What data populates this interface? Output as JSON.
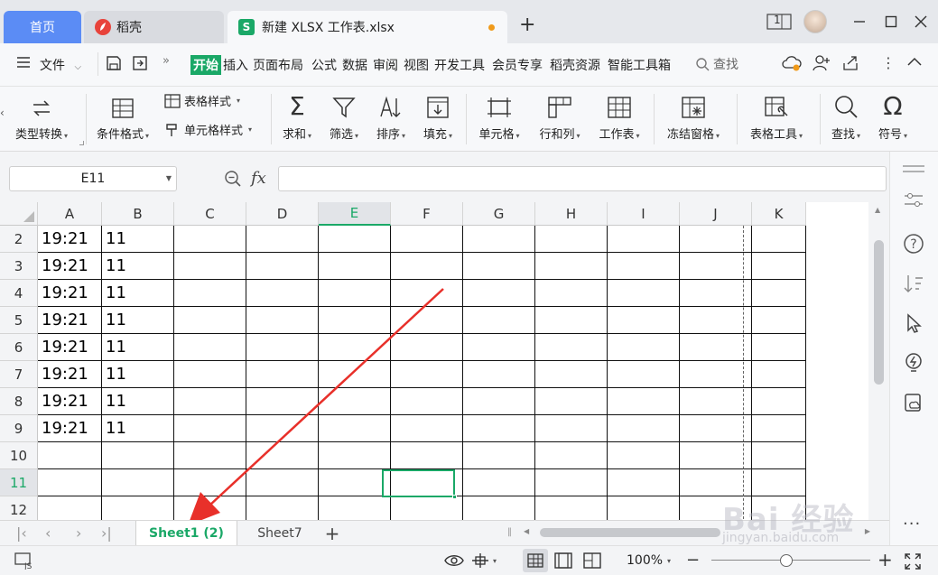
{
  "titlebar": {
    "home_tab": "首页",
    "daoke_tab": "稻壳",
    "file_tab": "新建 XLSX 工作表.xlsx",
    "new_tab": "+",
    "window_count": "1"
  },
  "menubar": {
    "file_menu": "文件",
    "items": [
      "开始",
      "插入",
      "页面布局",
      "公式",
      "数据",
      "审阅",
      "视图",
      "开发工具",
      "会员专享",
      "稻壳资源",
      "智能工具箱"
    ],
    "search": "查找"
  },
  "ribbon": {
    "type_convert": "类型转换",
    "cond_format": "条件格式",
    "table_style": "表格样式",
    "cell_style": "单元格样式",
    "sum": "求和",
    "filter": "筛选",
    "sort": "排序",
    "fill": "填充",
    "cell": "单元格",
    "row_col": "行和列",
    "worksheet": "工作表",
    "freeze": "冻结窗格",
    "table_tools": "表格工具",
    "find": "查找",
    "symbol": "符号"
  },
  "formula": {
    "name_box": "E11",
    "fx_label": "fx",
    "content": ""
  },
  "grid": {
    "columns": [
      "A",
      "B",
      "C",
      "D",
      "E",
      "F",
      "G",
      "H",
      "I",
      "J",
      "K"
    ],
    "selected_column": "E",
    "selected_row": "11",
    "rows": [
      {
        "num": "2",
        "a": "19:21",
        "b": "11"
      },
      {
        "num": "3",
        "a": "19:21",
        "b": "11"
      },
      {
        "num": "4",
        "a": "19:21",
        "b": "11"
      },
      {
        "num": "5",
        "a": "19:21",
        "b": "11"
      },
      {
        "num": "6",
        "a": "19:21",
        "b": "11"
      },
      {
        "num": "7",
        "a": "19:21",
        "b": "11"
      },
      {
        "num": "8",
        "a": "19:21",
        "b": "11"
      },
      {
        "num": "9",
        "a": "19:21",
        "b": "11"
      },
      {
        "num": "10",
        "a": "",
        "b": ""
      },
      {
        "num": "11",
        "a": "",
        "b": ""
      },
      {
        "num": "12",
        "a": "",
        "b": ""
      }
    ]
  },
  "sheets": {
    "active": "Sheet1 (2)",
    "other": "Sheet7",
    "add": "+"
  },
  "status": {
    "zoom": "100%"
  },
  "watermark": {
    "brand": "Bai 经验",
    "url": "jingyan.baidu.com"
  },
  "colors": {
    "accent_green": "#1aa867",
    "home_tab_blue": "#5b8cf5",
    "annotation_red": "#e8302a"
  }
}
